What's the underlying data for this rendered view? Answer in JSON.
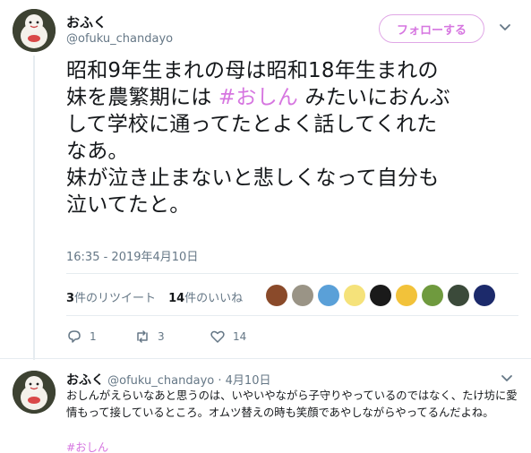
{
  "main_tweet": {
    "display_name": "おふく",
    "handle": "@ofuku_chandayo",
    "follow_label": "フォローする",
    "text_lines": [
      "昭和9年生まれの母は昭和18年生まれの",
      "妹を農繁期には",
      "#おしん",
      "みたいにおんぶ",
      "して学校に通ってたとよく話してくれた",
      "なあ。",
      "妹が泣き止まないと悲しくなって自分も",
      "泣いてたと。"
    ],
    "timestamp": "16:35 - 2019年4月10日",
    "retweet_count": "3",
    "retweet_label": "件のリツイート",
    "like_count": "14",
    "like_label": "件のいいね",
    "actions": {
      "reply_count": "1",
      "retweet_count": "3",
      "like_count": "14"
    }
  },
  "likers": [
    {
      "name": "liker-1",
      "color": "#8a4a2a"
    },
    {
      "name": "liker-2",
      "color": "#9a9486"
    },
    {
      "name": "liker-3",
      "color": "#5aa0d8"
    },
    {
      "name": "liker-4",
      "color": "#f5e27a"
    },
    {
      "name": "liker-5",
      "color": "#1a1a1a"
    },
    {
      "name": "liker-6",
      "color": "#f2c23a"
    },
    {
      "name": "liker-7",
      "color": "#6f9a3e"
    },
    {
      "name": "liker-8",
      "color": "#3b4a3a"
    },
    {
      "name": "liker-9",
      "color": "#1c2a6b"
    }
  ],
  "reply": {
    "display_name": "おふく",
    "handle": "@ofuku_chandayo",
    "date": "· 4月10日",
    "text": "おしんがえらいなあと思うのは、いやいやながら子守りやっているのではなく、たけ坊に愛情もって接しているところ。オムツ替えの時も笑顔であやしながらやってるんだよね。",
    "hashtag": "#おしん"
  },
  "colors": {
    "accent": "#d676e0",
    "muted": "#657786",
    "divider": "#e6ecf0"
  }
}
